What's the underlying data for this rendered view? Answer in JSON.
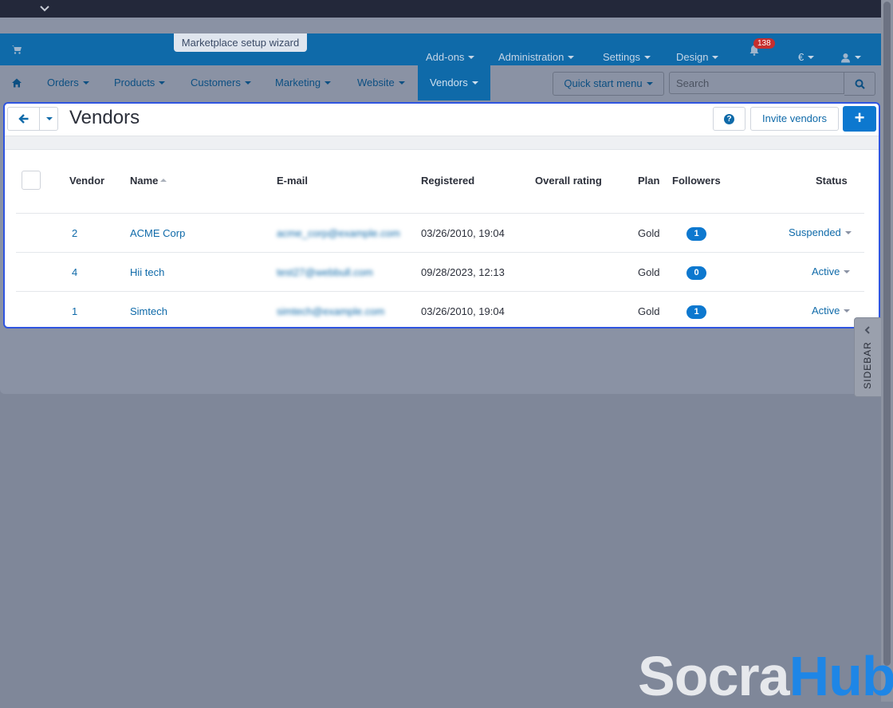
{
  "top": {
    "wizard_label": "Marketplace setup wizard"
  },
  "admin_menu": {
    "addons": "Add-ons",
    "administration": "Administration",
    "settings": "Settings",
    "design": "Design",
    "notifications_count": "138",
    "currency": "€"
  },
  "nav": {
    "orders": "Orders",
    "products": "Products",
    "customers": "Customers",
    "marketing": "Marketing",
    "website": "Website",
    "vendors": "Vendors",
    "quick_start": "Quick start menu",
    "search_placeholder": "Search"
  },
  "page": {
    "title": "Vendors",
    "invite_label": "Invite vendors",
    "add_label": "+",
    "help_label": "?"
  },
  "table": {
    "headers": {
      "vendor": "Vendor",
      "name": "Name",
      "email": "E-mail",
      "registered": "Registered",
      "rating": "Overall rating",
      "plan": "Plan",
      "followers": "Followers",
      "status": "Status"
    },
    "rows": [
      {
        "id": "2",
        "name": "ACME Corp",
        "email": "acme_corp@example.com",
        "registered": "03/26/2010, 19:04",
        "plan": "Gold",
        "followers": "1",
        "status": "Suspended"
      },
      {
        "id": "4",
        "name": "Hii tech",
        "email": "test27@webbull.com",
        "registered": "09/28/2023, 12:13",
        "plan": "Gold",
        "followers": "0",
        "status": "Active"
      },
      {
        "id": "1",
        "name": "Simtech",
        "email": "simtech@example.com",
        "registered": "03/26/2010, 19:04",
        "plan": "Gold",
        "followers": "1",
        "status": "Active"
      }
    ]
  },
  "sidebar": {
    "label": "SIDEBAR"
  },
  "watermark": {
    "part1": "Socra",
    "part2": "Hub"
  },
  "colors": {
    "primary": "#0f6aa9",
    "button": "#0d78cf",
    "highlight": "#2f55e0",
    "badge": "#c62f2f"
  }
}
